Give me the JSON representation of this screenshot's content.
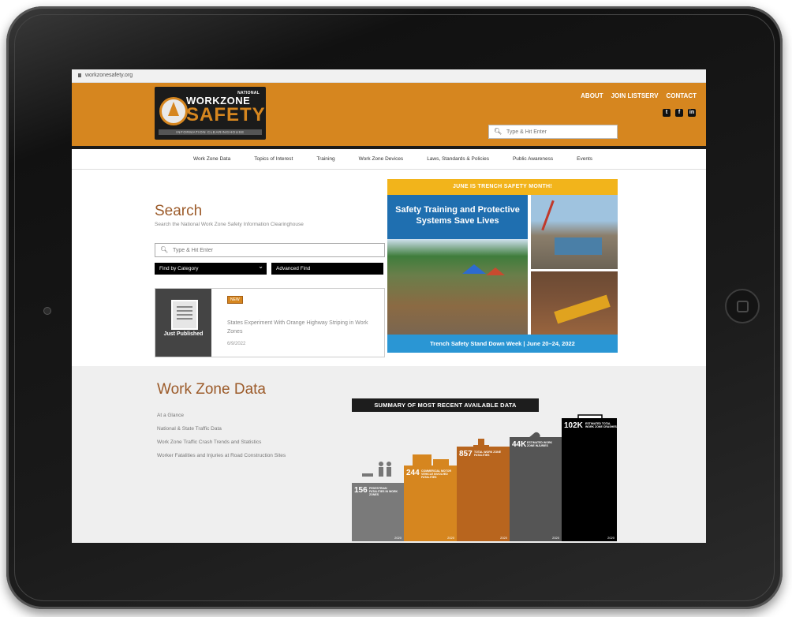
{
  "browser": {
    "url": "workzonesafety.org"
  },
  "logo": {
    "national": "NATIONAL",
    "workzone": "WORKZONE",
    "safety": "SAFETY",
    "subtitle": "INFORMATION CLEARINGHOUSE"
  },
  "header": {
    "links": [
      "ABOUT",
      "JOIN LISTSERV",
      "CONTACT"
    ],
    "social_icons": [
      "twitter-icon",
      "facebook-icon",
      "linkedin-icon"
    ],
    "search_placeholder": "Type & Hit Enter"
  },
  "nav": {
    "items": [
      "Work Zone Data",
      "Topics of Interest",
      "Training",
      "Work Zone Devices",
      "Laws, Standards & Policies",
      "Public Awareness",
      "Events"
    ]
  },
  "search": {
    "title": "Search",
    "subtitle": "Search the National Work Zone Safety Information Clearinghouse",
    "placeholder": "Type & Hit Enter",
    "category_button": "Find by Category",
    "advanced_button": "Advanced Find"
  },
  "publication": {
    "side_label": "Just Published",
    "badge": "NEW",
    "title": "States Experiment With Orange Highway Striping in Work Zones",
    "date": "6/9/2022"
  },
  "banner": {
    "top": "JUNE IS TRENCH SAFETY MONTH!",
    "headline": "Safety Training and Protective Systems Save Lives",
    "bottom": "Trench Safety Stand Down Week  |  June 20–24, 2022"
  },
  "work_zone_data": {
    "title": "Work Zone Data",
    "links": [
      "At a Glance",
      "National & State Traffic Data",
      "Work Zone Traffic Crash Trends and Statistics",
      "Worker Fatalities and Injuries at Road Construction Sites"
    ]
  },
  "infographic": {
    "title": "SUMMARY OF MOST RECENT AVAILABLE DATA",
    "columns": [
      {
        "value": "156",
        "label": "PEDESTRIAN FATALITIES IN WORK ZONES",
        "year": "2020",
        "color": "#7a7a7a"
      },
      {
        "value": "244",
        "label": "COMMERCIAL MOTOR VEHICLE INVOLVED FATALITIES",
        "year": "2020",
        "color": "#d6861f"
      },
      {
        "value": "857",
        "label": "TOTAL WORK ZONE FATALITIES",
        "year": "2020",
        "color": "#b8651e"
      },
      {
        "value": "44K",
        "label": "ESTIMATED WORK ZONE INJURIES",
        "year": "2020",
        "color": "#555555"
      },
      {
        "value": "102K",
        "label": "ESTIMATED TOTAL WORK ZONE CRASHES",
        "year": "2020",
        "color": "#000000"
      }
    ]
  }
}
